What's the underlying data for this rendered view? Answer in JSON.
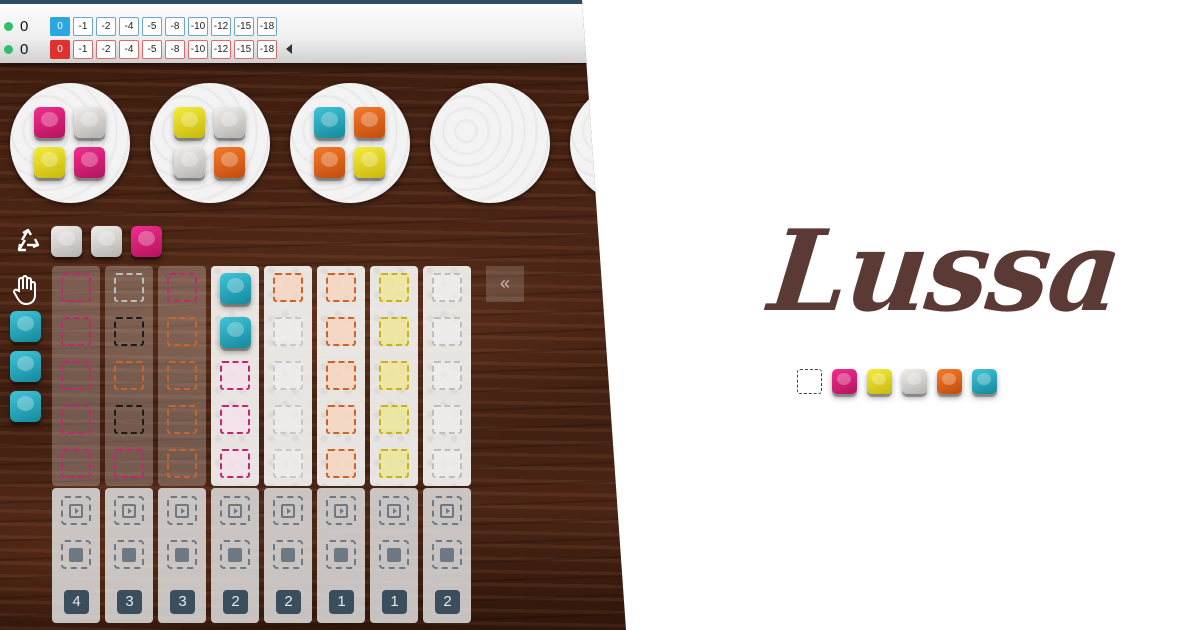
{
  "players": [
    {
      "score": "0",
      "scale": [
        "0",
        "-1",
        "-2",
        "-4",
        "-5",
        "-8",
        "-10",
        "-12",
        "-15",
        "-18"
      ],
      "current_color": "#2aa7e0"
    },
    {
      "score": "0",
      "scale": [
        "0",
        "-1",
        "-2",
        "-4",
        "-5",
        "-8",
        "-10",
        "-12",
        "-15",
        "-18"
      ],
      "current_color": "#e0302f"
    }
  ],
  "factories": [
    [
      "pink",
      "gray",
      "yellow",
      "pink"
    ],
    [
      "yellow",
      "gray",
      "gray",
      "orange"
    ],
    [
      "teal",
      "orange",
      "orange",
      "yellow"
    ],
    [],
    []
  ],
  "discard_tiles": [
    "gray",
    "gray",
    "pink"
  ],
  "hand_tiles": [
    "teal",
    "teal",
    "teal"
  ],
  "columns": [
    {
      "color": "pink",
      "filled": 0,
      "lit": false
    },
    {
      "color": "black",
      "filled": 0,
      "lit": false
    },
    {
      "color": "orange",
      "filled": 0,
      "lit": false
    },
    {
      "color": "pink",
      "filled": 2,
      "fill_color": "teal",
      "lit": true
    },
    {
      "color": "orange",
      "filled": 0,
      "lit": true
    },
    {
      "color": "orange",
      "filled": 0,
      "lit": true
    },
    {
      "color": "yellow",
      "filled": 0,
      "lit": true
    },
    {
      "color": "gray",
      "filled": 0,
      "lit": true
    }
  ],
  "column_counts": [
    "4",
    "3",
    "3",
    "2",
    "2",
    "1",
    "1",
    "2"
  ],
  "collapse_label": "«",
  "brand": {
    "title": "Lussa",
    "title_color": "#5b3a35"
  },
  "legend_tiles": [
    "pink",
    "yellow",
    "gray",
    "orange",
    "teal"
  ],
  "colors": {
    "pink": "#e0237f",
    "yellow": "#e5dc25",
    "gray": "#d6d3cf",
    "orange": "#e4621b",
    "teal": "#2aaabf",
    "black": "#222222"
  }
}
